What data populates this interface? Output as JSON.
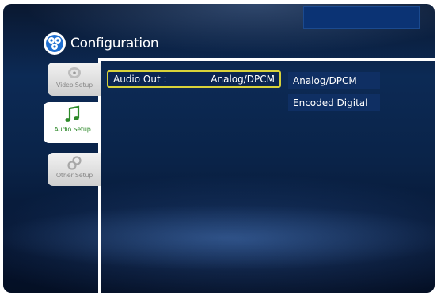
{
  "header": {
    "title": "Configuration",
    "icon": "gear-icon"
  },
  "tabs": [
    {
      "label": "Video Setup",
      "icon": "disc-icon",
      "active": false
    },
    {
      "label": "Audio Setup",
      "icon": "music-note-icon",
      "active": true
    },
    {
      "label": "Other Setup",
      "icon": "link-rings-icon",
      "active": false
    }
  ],
  "audio_out": {
    "label": "Audio Out :",
    "value": "Analog/DPCM"
  },
  "options": [
    "Analog/DPCM",
    "Encoded Digital"
  ],
  "colors": {
    "highlight_border": "#d8d23a",
    "option_bg": "#0f2f63",
    "active_tab_text": "#2e8a2a",
    "background": "#0c2a55"
  }
}
